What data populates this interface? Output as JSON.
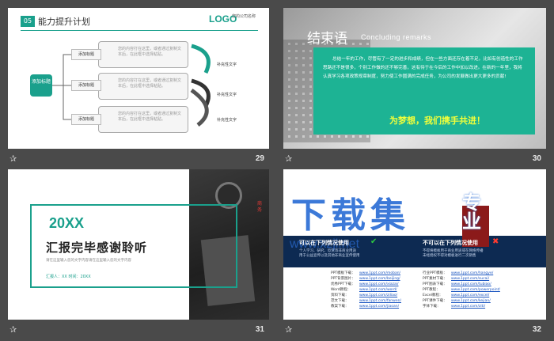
{
  "slides": [
    {
      "number": "29",
      "badge": "05",
      "title": "能力提升计划",
      "logo": "LOGO",
      "company": "您的公司名称",
      "center": "添加标题",
      "branches": [
        {
          "label": "添加标题",
          "desc": "您的内容打在这里，或者通过复制文本后，在此框中选择粘贴。"
        },
        {
          "label": "添加标题",
          "desc": "您的内容打在这里，或者通过复制文本后，在此框中选择粘贴。"
        },
        {
          "label": "添加标题",
          "desc": "您的内容打在这里，或者通过复制文本后，在此框中选择粘贴。"
        }
      ],
      "supplements": [
        "补充性文字",
        "补充性文字",
        "补充性文字"
      ]
    },
    {
      "number": "30",
      "title_cn": "结束语",
      "title_en": "Concluding   remarks",
      "body": "总结一年的工作，尽管有了一定的进步和成绩，但在一些方面还存在着不足。比如有创造性的工作思路还不是很多，个别工作做的还不够完善，这有待于在今后的工作中加以改进。在新的一年里，我将认真学习各项政策规章制度，努力使工作圆满的完成任务，为公司的发展做出更大更多的贡献!",
      "slogan": "为梦想，我们携手共进！"
    },
    {
      "number": "31",
      "year": "20XX",
      "title": "汇报完毕感谢聆听",
      "subline": "请在这里输入您的文字内容请在这里输入您的文字内容",
      "presenter": "汇报人：XX    时间：20XX",
      "vertical": "商务"
    },
    {
      "number": "32",
      "big_title": "下载集",
      "url": "www.xzji.net",
      "zhuanye": "专业",
      "can_title": "可以在下列情况使用",
      "can_lines": [
        "个人学习、研究、欣赏等非商业用途",
        "用于公益宣传以及其他非商业宣传使用"
      ],
      "cannot_title": "不可以在下列情况使用",
      "cannot_lines": [
        "不得将模板用于商业用途或在网络传播",
        "未经授权不得对模板进行二次销售"
      ],
      "links_left": [
        {
          "k": "PPT模板下载：",
          "v": "www.1ppt.com/moban/"
        },
        {
          "k": "PPT背景图片：",
          "v": "www.1ppt.com/beijing/"
        },
        {
          "k": "优秀PPT下载：",
          "v": "www.1ppt.com/xiazai/"
        },
        {
          "k": "Word教程：",
          "v": "www.1ppt.com/word/"
        },
        {
          "k": "资料下载：",
          "v": "www.1ppt.com/ziliao/"
        },
        {
          "k": "范文下载：",
          "v": "www.1ppt.com/fanwen/"
        },
        {
          "k": "教案下载：",
          "v": "www.1ppt.com/jiaoan/"
        }
      ],
      "links_right": [
        {
          "k": "行业PPT模板：",
          "v": "www.1ppt.com/hangye/"
        },
        {
          "k": "PPT素材下载：",
          "v": "www.1ppt.com/sucai/"
        },
        {
          "k": "PPT图表下载：",
          "v": "www.1ppt.com/tubiao/"
        },
        {
          "k": "PPT教程：",
          "v": "www.1ppt.com/powerpoint/"
        },
        {
          "k": "Excel教程：",
          "v": "www.1ppt.com/excel/"
        },
        {
          "k": "PPT课件下载：",
          "v": "www.1ppt.com/kejian/"
        },
        {
          "k": "字体下载：",
          "v": "www.1ppt.com/ziti/"
        }
      ]
    }
  ],
  "colors": {
    "teal": "#1aa08c",
    "green": "#1db394",
    "slogan": "#f2ff3a",
    "navy": "#0d2a52",
    "blue": "#2c6ed5"
  },
  "icons": {
    "footer": "star-icon",
    "check": "check-icon",
    "cross": "cross-icon"
  }
}
